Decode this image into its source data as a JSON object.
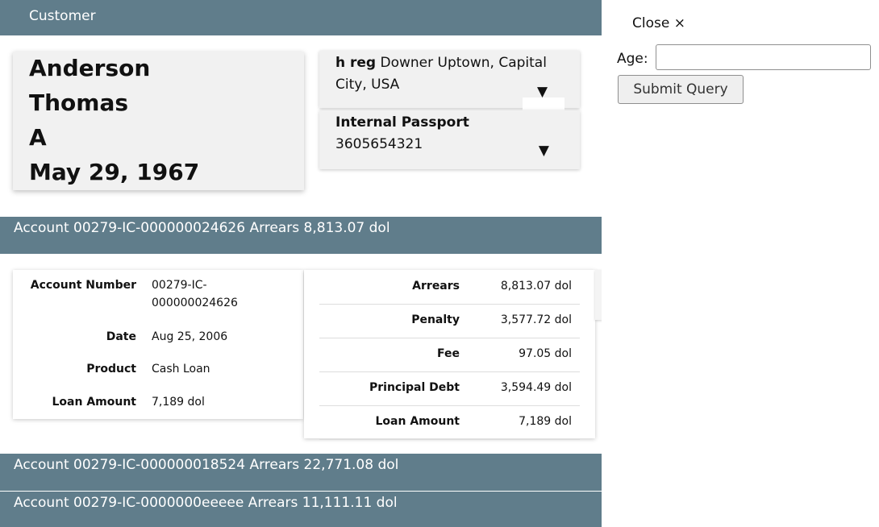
{
  "header": {
    "title": "Customer"
  },
  "customer": {
    "last_name": "Anderson",
    "first_name": "Thomas",
    "middle_initial": "A",
    "birth_date": "May 29, 1967"
  },
  "documents": {
    "registration": {
      "label": "h reg",
      "value": "Downer Uptown, Capital City, USA",
      "toggle_icon": "▼"
    },
    "passport": {
      "label": "Internal Passport",
      "value": "3605654321",
      "toggle_icon": "▼"
    }
  },
  "accounts": [
    {
      "summary": "Account 00279-IC-000000024626 Arrears 8,813.07 dol"
    },
    {
      "summary": "Account 00279-IC-000000018524 Arrears 22,771.08 dol"
    },
    {
      "summary": "Account 00279-IC-0000000eeeee Arrears 11,111.11 dol"
    }
  ],
  "account_details": {
    "info": [
      {
        "label": "Account Number",
        "value": "00279-IC-000000024626"
      },
      {
        "label": "Date",
        "value": "Aug 25, 2006"
      },
      {
        "label": "Product",
        "value": "Cash Loan"
      },
      {
        "label": "Loan Amount",
        "value": "7,189 dol"
      }
    ],
    "financials": [
      {
        "label": "Arrears",
        "value": "8,813.07 dol"
      },
      {
        "label": "Penalty",
        "value": "3,577.72 dol"
      },
      {
        "label": "Fee",
        "value": "97.05 dol"
      },
      {
        "label": "Principal Debt",
        "value": "3,594.49 dol"
      },
      {
        "label": "Loan Amount",
        "value": "7,189 dol"
      }
    ]
  },
  "side_panel": {
    "close_label": "Close ×",
    "age_label": "Age:",
    "age_value": "",
    "submit_label": "Submit Query"
  }
}
